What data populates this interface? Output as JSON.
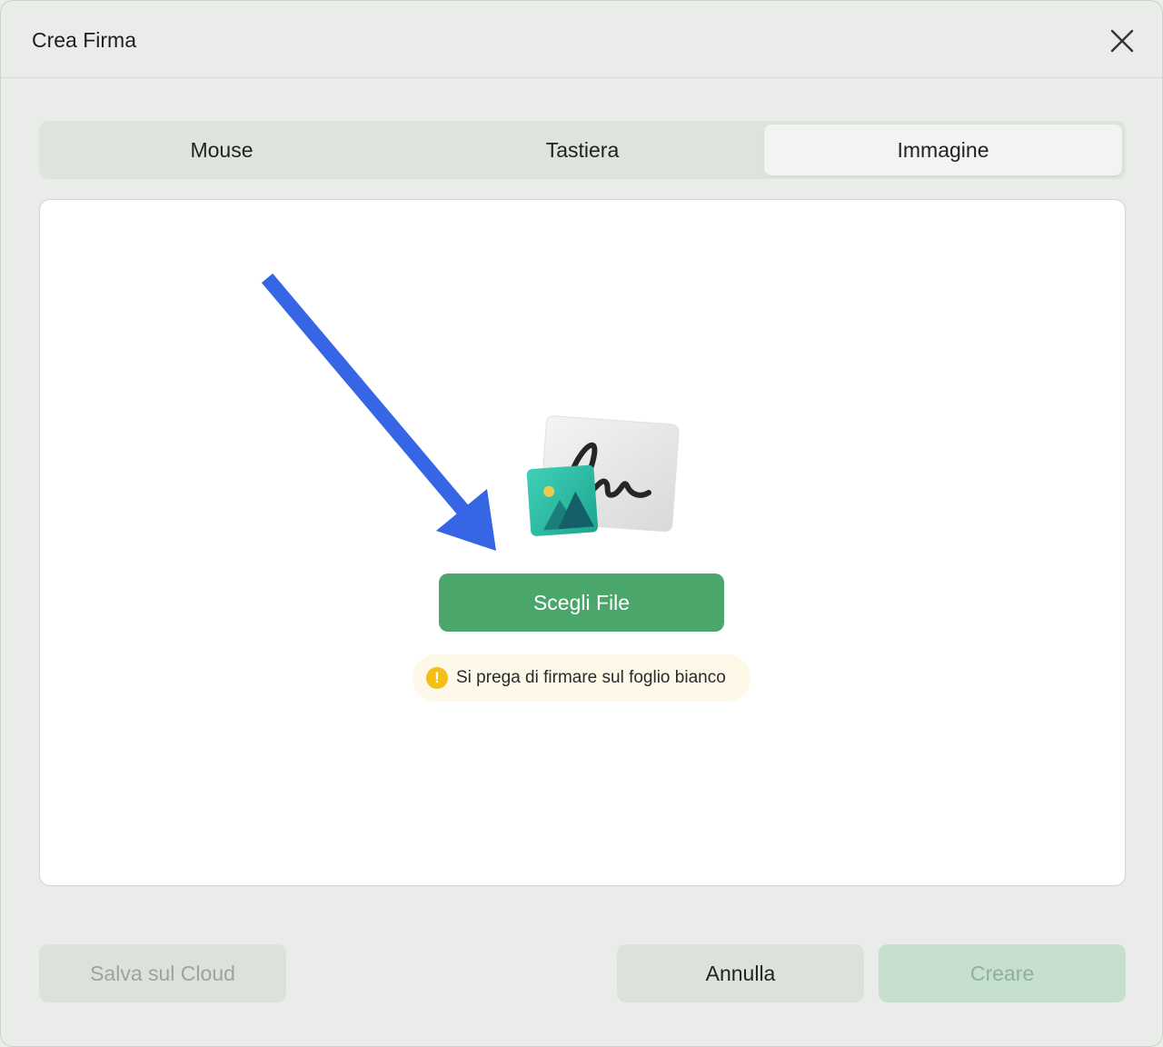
{
  "dialog": {
    "title": "Crea Firma",
    "close_icon": "close-icon"
  },
  "tabs": [
    {
      "label": "Mouse",
      "active": false
    },
    {
      "label": "Tastiera",
      "active": false
    },
    {
      "label": "Immagine",
      "active": true
    }
  ],
  "panel": {
    "illustration": "image-signature-illustration",
    "choose_file_label": "Scegli File",
    "hint_icon": "warning-icon",
    "hint_text": "Si prega di firmare sul foglio bianco"
  },
  "footer": {
    "save_cloud_label": "Salva sul Cloud",
    "cancel_label": "Annulla",
    "create_label": "Creare"
  },
  "colors": {
    "accent": "#4aa66b",
    "arrow": "#3666e6",
    "warning": "#f3be16"
  }
}
